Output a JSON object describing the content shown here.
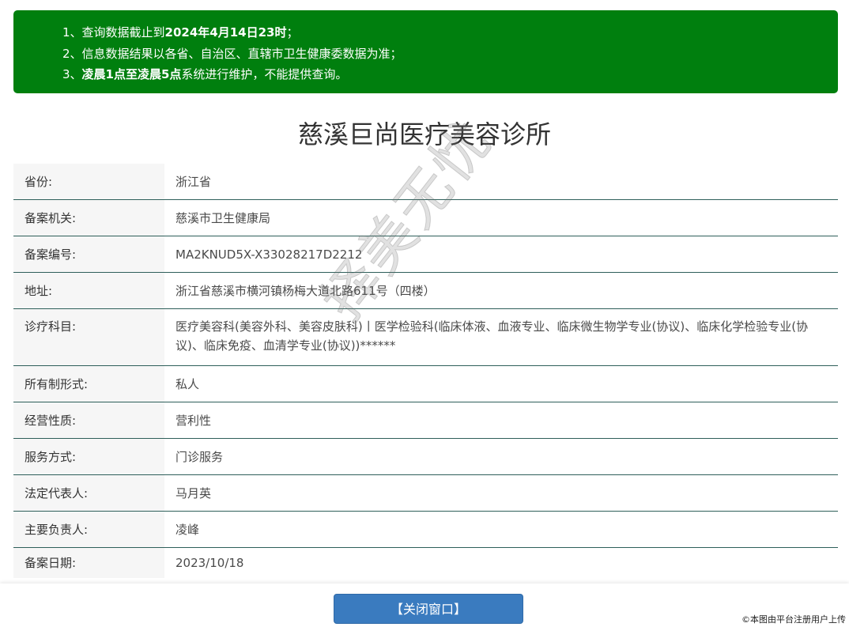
{
  "notice": {
    "line1": {
      "prefix": "1、查询数据截止到",
      "bold": "2024年4月14日23时",
      "suffix": "；"
    },
    "line2": "2、信息数据结果以各省、自治区、直辖市卫生健康委数据为准；",
    "line3": {
      "prefix": "3、",
      "bold": "凌晨1点至凌晨5点",
      "suffix": "系统进行维护，不能提供查询。"
    }
  },
  "title": "慈溪巨尚医疗美容诊所",
  "rows": [
    {
      "label": "省份:",
      "value": "浙江省"
    },
    {
      "label": "备案机关:",
      "value": "慈溪市卫生健康局"
    },
    {
      "label": "备案编号:",
      "value": "MA2KNUD5X-X33028217D2212"
    },
    {
      "label": "地址:",
      "value": "浙江省慈溪市横河镇杨梅大道北路611号（四楼）"
    },
    {
      "label": "诊疗科目:",
      "value": "医疗美容科(美容外科、美容皮肤科)丨医学检验科(临床体液、血液专业、临床微生物学专业(协议)、临床化学检验专业(协议)、临床免疫、血清学专业(协议))******"
    },
    {
      "label": "所有制形式:",
      "value": "私人"
    },
    {
      "label": "经营性质:",
      "value": "营利性"
    },
    {
      "label": "服务方式:",
      "value": "门诊服务"
    },
    {
      "label": "法定代表人:",
      "value": "马月英"
    },
    {
      "label": "主要负责人:",
      "value": "凌峰"
    },
    {
      "label": "备案日期:",
      "value": "2023/10/18"
    }
  ],
  "close_button": "【关闭窗口】",
  "watermark": "择美无忧",
  "credit": "©本图由平台注册用户上传"
}
